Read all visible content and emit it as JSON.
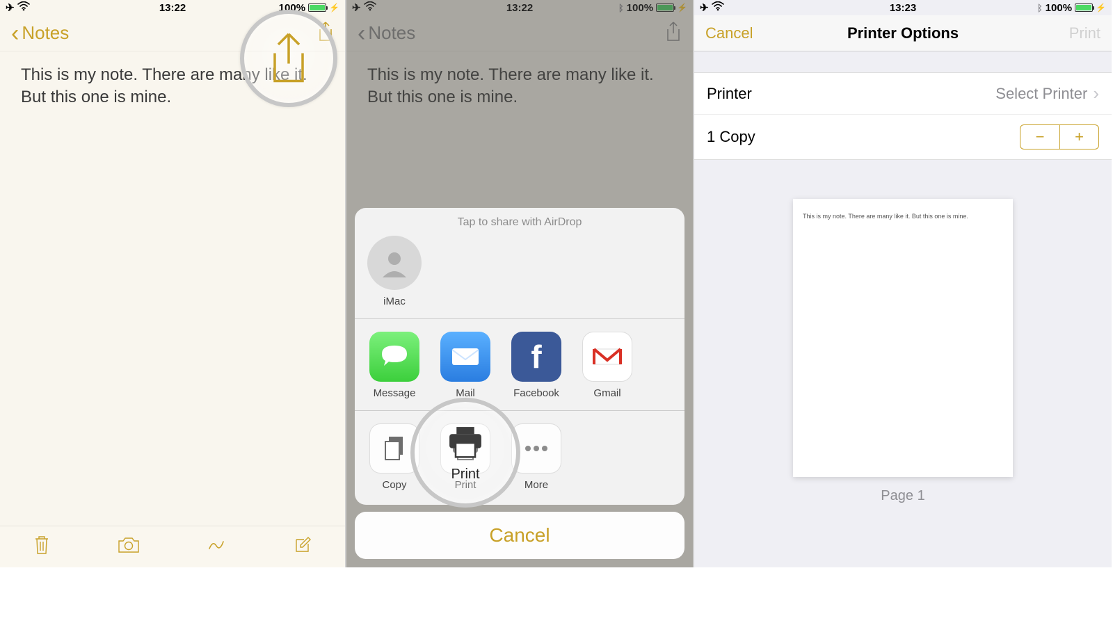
{
  "status": {
    "time1": "13:22",
    "time2": "13:22",
    "time3": "13:23",
    "batt": "100%"
  },
  "nav": {
    "back": "Notes",
    "cancel": "Cancel",
    "printer_options": "Printer Options",
    "print": "Print"
  },
  "note": {
    "text": "This is my note. There are many like it. But this one is mine."
  },
  "sheet": {
    "airdrop_hint": "Tap to share with AirDrop",
    "airdrop_target": "iMac",
    "apps": [
      "Message",
      "Mail",
      "Facebook",
      "Gmail"
    ],
    "actions": [
      "Copy",
      "Print",
      "More"
    ],
    "cancel": "Cancel"
  },
  "printer": {
    "row_printer": "Printer",
    "select_printer": "Select Printer",
    "copies": "1 Copy",
    "page_label": "Page 1",
    "preview_text": "This is my note. There are many like it. But this one is mine."
  }
}
